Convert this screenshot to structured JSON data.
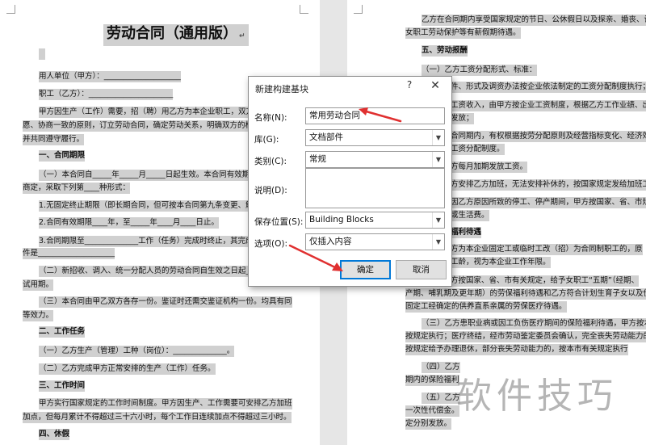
{
  "left_doc": {
    "title": "劳动合同（通用版）",
    "lines": [
      "用人单位（甲方）：____________________",
      "职工（乙方）：______________________",
      "甲方因生产（工作）需要，招（聘）用乙方为本企业职工，双方",
      "愿、协商一致的原则，订立劳动合同，确定劳动关系，明确双方的权",
      "并共同遵守履行。",
      "一、合同期限",
      "（一）本合同自_____年_____月_____日起生效。本合同有效期经",
      "商定，采取下列第____种形式：",
      "1.无固定终止期限（即长期合同，但可按本合同第九条变更、解除",
      "2.合同有效期限____年，至_____年____月____日止。",
      "3.合同期限至______________工作（任务）完成时终止，其完成",
      "件是____________________",
      "（二）新招收、调入、统一分配人员的劳动合同自生效之日起_____",
      "试用期。",
      "（三）本合同由甲乙双方各存一份。鉴证时还需交鉴证机构一份。均具有同",
      "等效力。",
      "二、工作任务",
      "（一）乙方生产（管理）工种（岗位）：______________。",
      "（二）乙方完成甲方正常安排的生产（工作）任务。",
      "三、工作时间",
      "甲方实行国家规定的工作时间制度。甲方因生产、工作需要可安排乙方加班",
      "加点，但每月累计不得超过三十六小时，每个工作日连续加点不得超过三小时。",
      "四、休假"
    ]
  },
  "right_doc": {
    "lines": [
      "乙方在合同期内享受国家规定的节日、公休假日以及探亲、婚丧、计划生",
      "女职工劳动保护等有薪假期待遇。",
      "五、劳动报酬",
      "（一）乙方工资分配形式、标准：",
      "件、形式及调资办法按企业依法制定的工资分配制度执行；",
      "工资收入，由甲方按企业工资制度，根据乙方工作业绩、出勤",
      "发放；",
      "合同期内，有权根据按劳分配原则及经营指标变化、经济效益",
      "工资分配制度。",
      "方每月加期发放工资。",
      "方安排乙方加班，无法安排补休的，按国家规定发给加班工资",
      "因乙方原因所致的停工、停产期间，甲方按国家、省、市规定",
      "或生活费。",
      "福利待遇",
      "方为本企业固定工或临时工改（招）为合同制职工的，原",
      "工龄，视为本企业工作年限。",
      "方按国家、省、市有关规定，给予女职工“五期”（经期、",
      "产期、哺乳期及更年期）的劳保福利待遇和乙方符合计划生育子女以及伤",
      "固定工经确定的供养直系亲属的劳保医疗待遇。",
      "（三）乙方患职业病或因工负伤医疗期间的保险福利待遇，甲方按本市",
      "按规定执行；医疗终结，经市劳动鉴定委员会确认，完全丧失劳动能力的，由",
      "按规定给予办理退休，部分丧失劳动能力的，按本市有关规定执行",
      "（四）乙方",
      "期内的保险福利",
      "（五）乙方",
      "一次性代偿金。",
      "定分别发放。"
    ]
  },
  "dialog": {
    "title": "新建构建基块",
    "help": "?",
    "close": "✕",
    "fields": [
      {
        "label": "名称(N):",
        "value": "常用劳动合同"
      },
      {
        "label": "库(G):",
        "value": "文档部件"
      },
      {
        "label": "类别(C):",
        "value": "常规"
      },
      {
        "label": "说明(D):",
        "value": ""
      },
      {
        "label": "保存位置(S):",
        "value": "Building Blocks"
      },
      {
        "label": "选项(O):",
        "value": "仅插入内容"
      }
    ],
    "ok_label": "确定",
    "cancel_label": "取消"
  },
  "watermark": "软件技巧",
  "colors": {
    "highlight": "#d0d0d0",
    "arrow": "#e03030",
    "accent": "#0078d7"
  }
}
